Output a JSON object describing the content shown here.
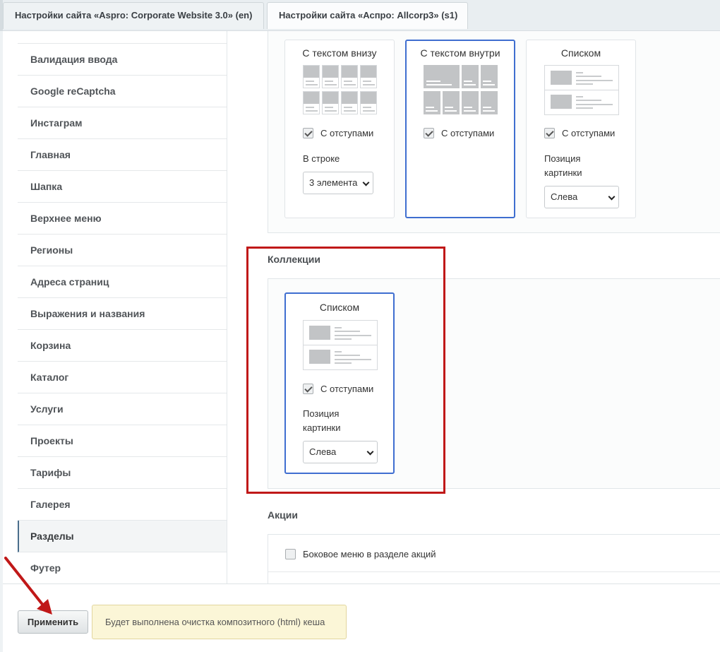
{
  "tabs": [
    {
      "label": "Настройки сайта «Aspro: Corporate Website 3.0» (en)"
    },
    {
      "label": "Настройки сайта «Аспро: Allcorp3» (s1)"
    }
  ],
  "sidebar": {
    "items": [
      {
        "label": "Валидация ввода"
      },
      {
        "label": "Google reCaptcha"
      },
      {
        "label": "Инстаграм"
      },
      {
        "label": "Главная"
      },
      {
        "label": "Шапка"
      },
      {
        "label": "Верхнее меню"
      },
      {
        "label": "Регионы"
      },
      {
        "label": "Адреса страниц"
      },
      {
        "label": "Выражения и названия"
      },
      {
        "label": "Корзина"
      },
      {
        "label": "Каталог"
      },
      {
        "label": "Услуги"
      },
      {
        "label": "Проекты"
      },
      {
        "label": "Тарифы"
      },
      {
        "label": "Галерея"
      },
      {
        "label": "Разделы"
      },
      {
        "label": "Футер"
      }
    ],
    "active": "Разделы"
  },
  "top_group": {
    "cards": [
      {
        "title": "С текстом внизу",
        "checkbox": "С отступами",
        "checked": true,
        "select_label": "В строке",
        "select_value": "3 элемента"
      },
      {
        "title": "С текстом внутри",
        "checkbox": "С отступами",
        "checked": true,
        "selected": true
      },
      {
        "title": "Списком",
        "checkbox": "С отступами",
        "checked": true,
        "select_label": "Позиция картинки",
        "select_value": "Слева"
      }
    ]
  },
  "collections": {
    "title": "Коллекции",
    "card": {
      "title": "Списком",
      "checkbox": "С отступами",
      "checked": true,
      "select_label": "Позиция картинки",
      "select_value": "Слева",
      "selected": true
    }
  },
  "promotions": {
    "title": "Акции",
    "checkbox": "Боковое меню в разделе акций",
    "checked": false
  },
  "footer": {
    "apply_label": "Применить",
    "note": "Будет выполнена очистка композитного (html) кеша"
  },
  "colors": {
    "accent": "#3f6ed0",
    "highlight": "#c01818",
    "note_bg": "#fbf6d7"
  }
}
